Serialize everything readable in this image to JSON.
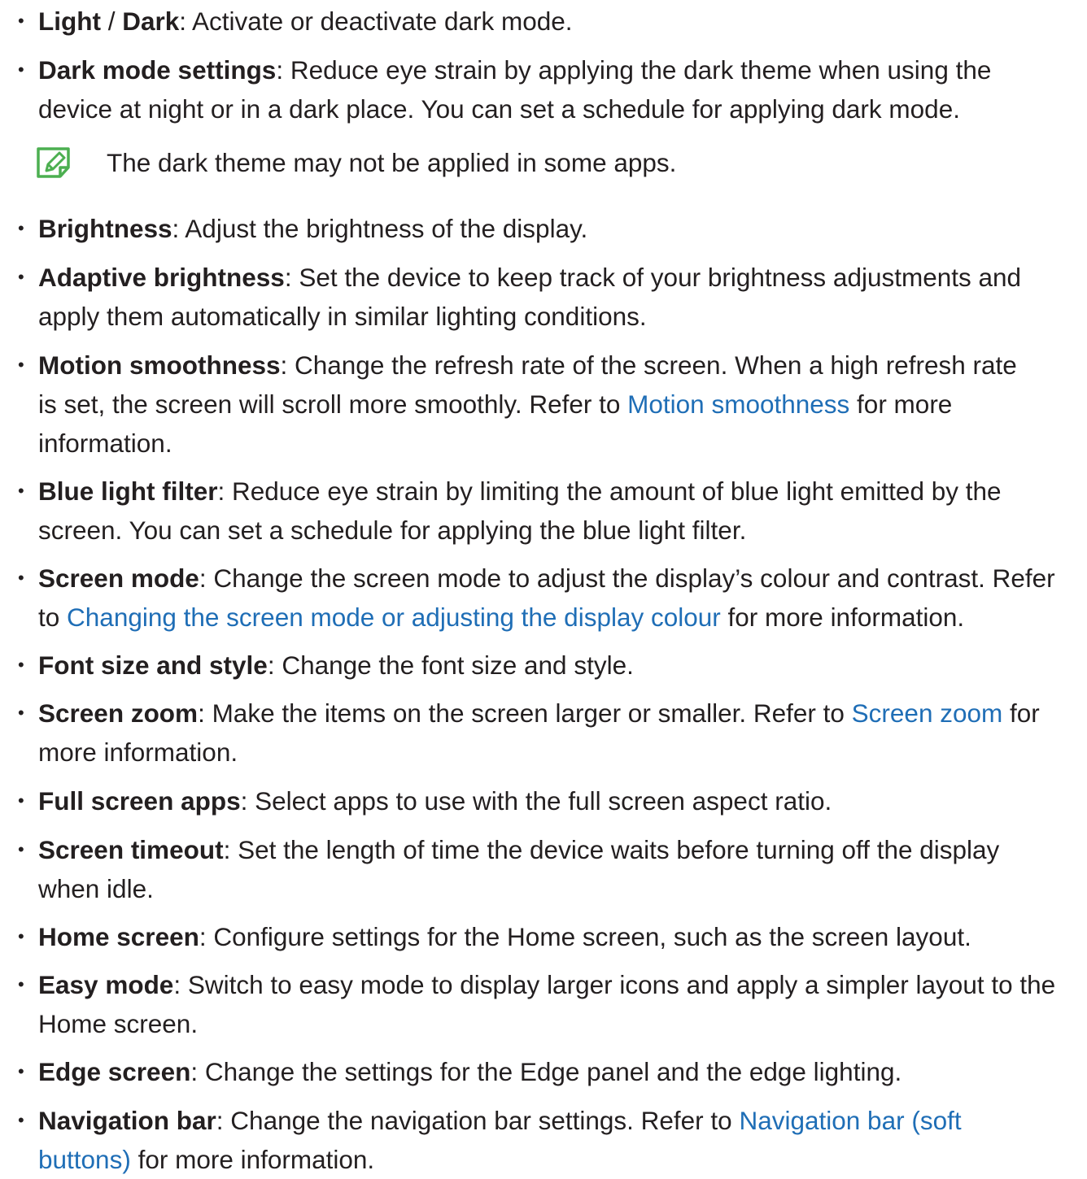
{
  "items": [
    {
      "term_a": "Light",
      "sep": " / ",
      "term_b": "Dark",
      "rest": ": Activate or deactivate dark mode."
    },
    {
      "term": "Dark mode settings",
      "lines": [
        ": Reduce eye strain by applying the dark theme when using the",
        "device at night or in a dark place. You can set a schedule for applying dark mode."
      ]
    },
    {
      "note": "The dark theme may not be applied in some apps."
    },
    {
      "term": "Brightness",
      "lines": [
        ": Adjust the brightness of the display."
      ]
    },
    {
      "term": "Adaptive brightness",
      "lines": [
        ": Set the device to keep track of your brightness adjustments and",
        "apply them automatically in similar lighting conditions."
      ]
    },
    {
      "term": "Motion smoothness",
      "line1": ": Change the refresh rate of the screen. When a high refresh rate",
      "line2_pre": "is set, the screen will scroll more smoothly. Refer to ",
      "line2_link": "Motion smoothness",
      "line2_post": " for more",
      "line3": "information."
    },
    {
      "term": "Blue light filter",
      "lines": [
        ": Reduce eye strain by limiting the amount of blue light emitted by the",
        "screen. You can set a schedule for applying the blue light filter."
      ]
    },
    {
      "term": "Screen mode",
      "line1": ": Change the screen mode to adjust the display’s colour and contrast. Refer",
      "line2_pre": "to ",
      "line2_link": "Changing the screen mode or adjusting the display colour",
      "line2_post": " for more information."
    },
    {
      "term": "Font size and style",
      "lines": [
        ": Change the font size and style."
      ]
    },
    {
      "term": "Screen zoom",
      "line1_pre": ": Make the items on the screen larger or smaller. Refer to ",
      "line1_link": "Screen zoom",
      "line1_post": " for",
      "line2": "more information."
    },
    {
      "term": "Full screen apps",
      "lines": [
        ": Select apps to use with the full screen aspect ratio."
      ]
    },
    {
      "term": "Screen timeout",
      "lines": [
        ": Set the length of time the device waits before turning off the display",
        "when idle."
      ]
    },
    {
      "term": "Home screen",
      "lines": [
        ": Configure settings for the Home screen, such as the screen layout."
      ]
    },
    {
      "term": "Easy mode",
      "lines": [
        ": Switch to easy mode to display larger icons and apply a simpler layout to the",
        "Home screen."
      ]
    },
    {
      "term": "Edge screen",
      "lines": [
        ": Change the settings for the Edge panel and the edge lighting."
      ]
    },
    {
      "term": "Navigation bar",
      "line1_pre": ": Change the navigation bar settings. Refer to ",
      "line1_link": "Navigation bar (soft",
      "line2_link": "buttons)",
      "line2_post": " for more information."
    }
  ],
  "bullet_char": "•",
  "colors": {
    "text": "#231f20",
    "link": "#1f6eb6",
    "note_icon": "#4caf50"
  },
  "icons": {
    "note": "note-pencil-icon"
  }
}
